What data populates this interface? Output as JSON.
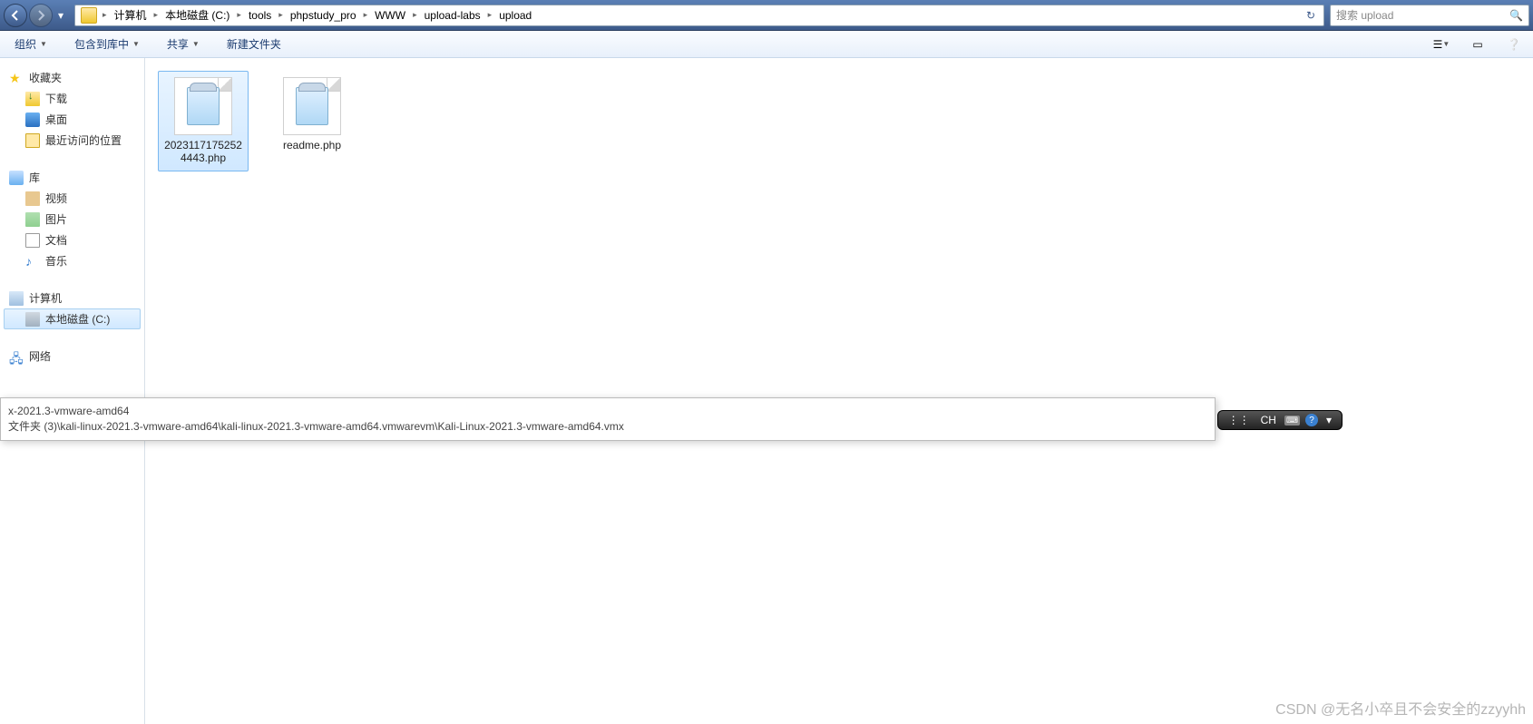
{
  "nav": {
    "breadcrumb": [
      "计算机",
      "本地磁盘 (C:)",
      "tools",
      "phpstudy_pro",
      "WWW",
      "upload-labs",
      "upload"
    ],
    "search_placeholder": "搜索 upload"
  },
  "toolbar": {
    "organize": "组织",
    "include": "包含到库中",
    "share": "共享",
    "newfolder": "新建文件夹"
  },
  "sidebar": {
    "favorites": {
      "label": "收藏夹",
      "items": [
        "下载",
        "桌面",
        "最近访问的位置"
      ]
    },
    "libraries": {
      "label": "库",
      "items": [
        "视频",
        "图片",
        "文档",
        "音乐"
      ]
    },
    "computer": {
      "label": "计算机",
      "items": [
        "本地磁盘 (C:)"
      ]
    },
    "network": {
      "label": "网络"
    }
  },
  "files": [
    {
      "name": "20231171752524443.php",
      "selected": true
    },
    {
      "name": "readme.php",
      "selected": false
    }
  ],
  "popup": {
    "line1": "x-2021.3-vmware-amd64",
    "line2": "文件夹 (3)\\kali-linux-2021.3-vmware-amd64\\kali-linux-2021.3-vmware-amd64.vmwarevm\\Kali-Linux-2021.3-vmware-amd64.vmx"
  },
  "ime": {
    "lang": "CH"
  },
  "watermark": "CSDN @无名小卒且不会安全的zzyyhh"
}
